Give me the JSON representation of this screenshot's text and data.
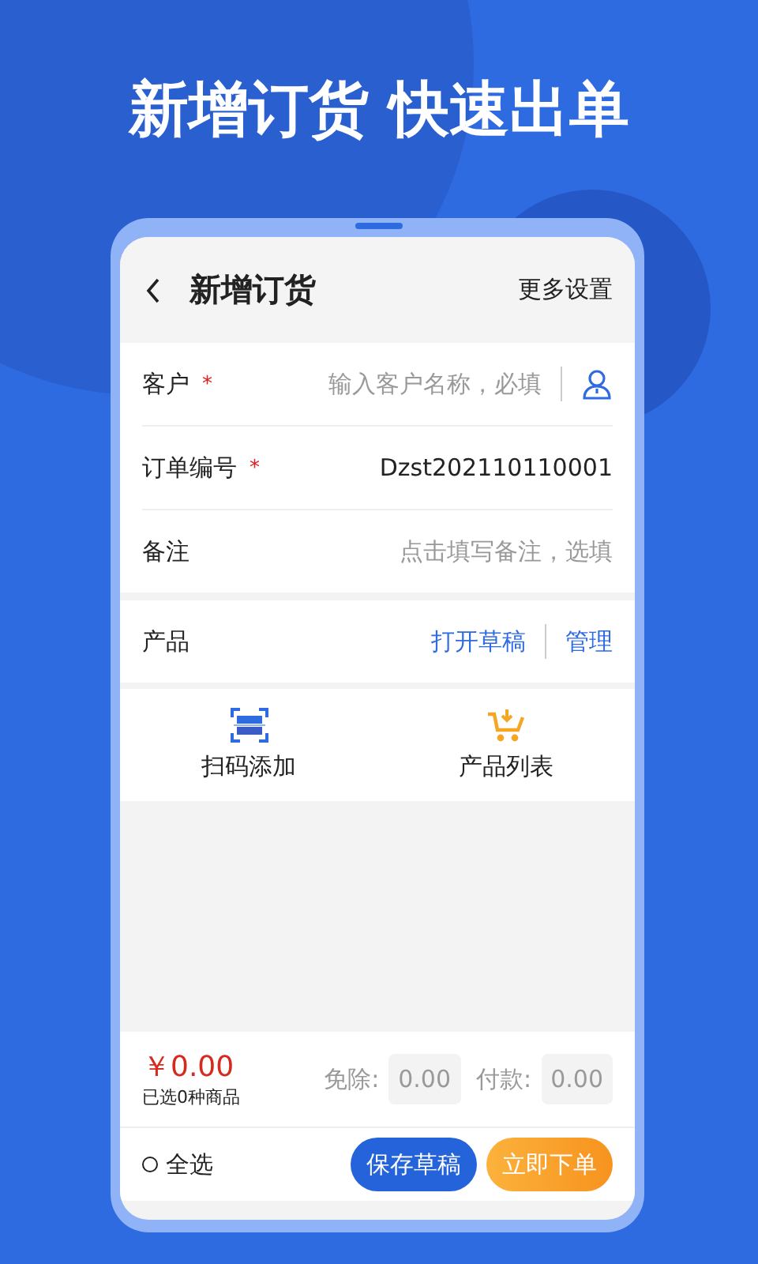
{
  "headline": "新增订货 快速出单",
  "header": {
    "title": "新增订货",
    "action": "更多设置"
  },
  "fields": [
    {
      "label": "客户",
      "required_mark": "*",
      "placeholder": "输入客户名称，必填",
      "kind": "picker"
    },
    {
      "label": "订单编号",
      "required_mark": "*",
      "value": "Dzst202110110001",
      "kind": "text"
    },
    {
      "label": "备注",
      "placeholder": "点击填写备注，选填",
      "kind": "text"
    }
  ],
  "products": {
    "label": "产品",
    "links": [
      "打开草稿",
      "管理"
    ]
  },
  "actions": [
    {
      "label": "扫码添加",
      "kind": "scan"
    },
    {
      "label": "产品列表",
      "kind": "cart"
    }
  ],
  "summary": {
    "total": "￥0.00",
    "count": "已选0种商品",
    "discount_label": "免除:",
    "discount_value": "0.00",
    "payment_label": "付款:",
    "payment_value": "0.00"
  },
  "footer": {
    "select_all": {
      "label": "全选",
      "checked": false
    },
    "buttons": [
      {
        "label": "保存草稿",
        "kind": "draft"
      },
      {
        "label": "立即下单",
        "kind": "order"
      }
    ]
  }
}
